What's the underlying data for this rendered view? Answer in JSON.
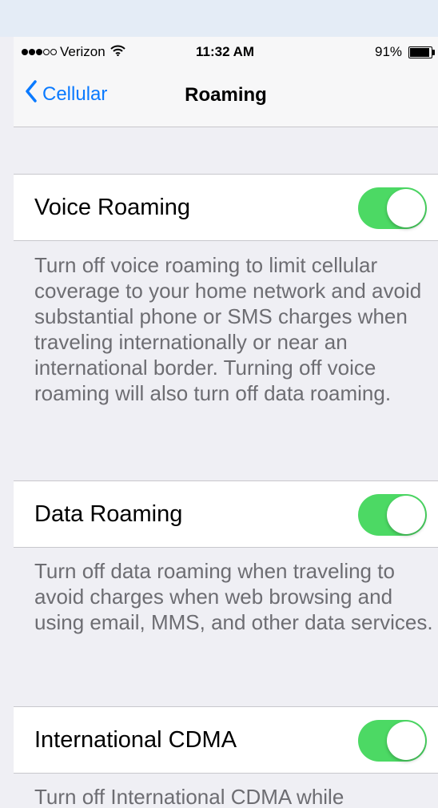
{
  "status_bar": {
    "signal": {
      "filled": 3,
      "total": 5
    },
    "carrier": "Verizon",
    "wifi_icon": "wifi-icon",
    "time": "11:32 AM",
    "battery_text": "91%",
    "battery_level": 0.91
  },
  "nav": {
    "back_label": "Cellular",
    "back_icon": "chevron-left-icon",
    "title": "Roaming",
    "tint_color": "#0a7aff"
  },
  "settings": [
    {
      "label": "Voice Roaming",
      "on": true,
      "footer": "Turn off voice roaming to limit cellular coverage to your home network and avoid substantial phone or SMS charges when traveling internationally or near an international border. Turning off voice roaming will also turn off data roaming."
    },
    {
      "label": "Data Roaming",
      "on": true,
      "footer": "Turn off data roaming when traveling to avoid charges when web browsing and using email, MMS, and other data services."
    },
    {
      "label": "International CDMA",
      "on": true,
      "footer": "Turn off International CDMA while"
    }
  ],
  "colors": {
    "toggle_on": "#4cd964",
    "background": "#efeff4",
    "footer_text": "#6d6d72"
  }
}
